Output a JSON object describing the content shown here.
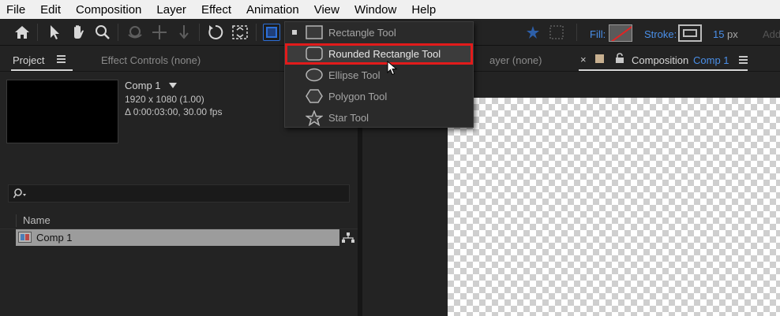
{
  "menubar": {
    "items": [
      "File",
      "Edit",
      "Composition",
      "Layer",
      "Effect",
      "Animation",
      "View",
      "Window",
      "Help"
    ]
  },
  "toolbar": {
    "fill_label": "Fill:",
    "stroke_label": "Stroke:",
    "stroke_width": "15",
    "stroke_unit": "px",
    "add_label": "Add",
    "accent_color": "#4a8fe8",
    "fill_color": "none",
    "stroke_color": "#bbbbbb"
  },
  "shape_menu": {
    "items": [
      {
        "label": "Rectangle Tool",
        "icon": "rectangle-icon",
        "active": true
      },
      {
        "label": "Rounded Rectangle Tool",
        "icon": "rounded-rectangle-icon",
        "highlighted": true
      },
      {
        "label": "Ellipse Tool",
        "icon": "ellipse-icon"
      },
      {
        "label": "Polygon Tool",
        "icon": "polygon-icon"
      },
      {
        "label": "Star Tool",
        "icon": "star-icon"
      }
    ]
  },
  "project_panel": {
    "tab_project": "Project",
    "tab_effect_controls": "Effect Controls (none)",
    "comp_name": "Comp 1",
    "comp_resolution": "1920 x 1080 (1.00)",
    "comp_duration": "Δ 0:00:03:00, 30.00 fps",
    "column_name": "Name",
    "items": [
      {
        "name": "Comp 1",
        "type": "composition"
      }
    ]
  },
  "viewer_panel": {
    "tab_layer": "Layer (none)",
    "tab_layer_visible": "ayer (none)",
    "close_glyph": "×",
    "tab_composition": "Composition",
    "tab_composition_name": "Comp 1"
  }
}
